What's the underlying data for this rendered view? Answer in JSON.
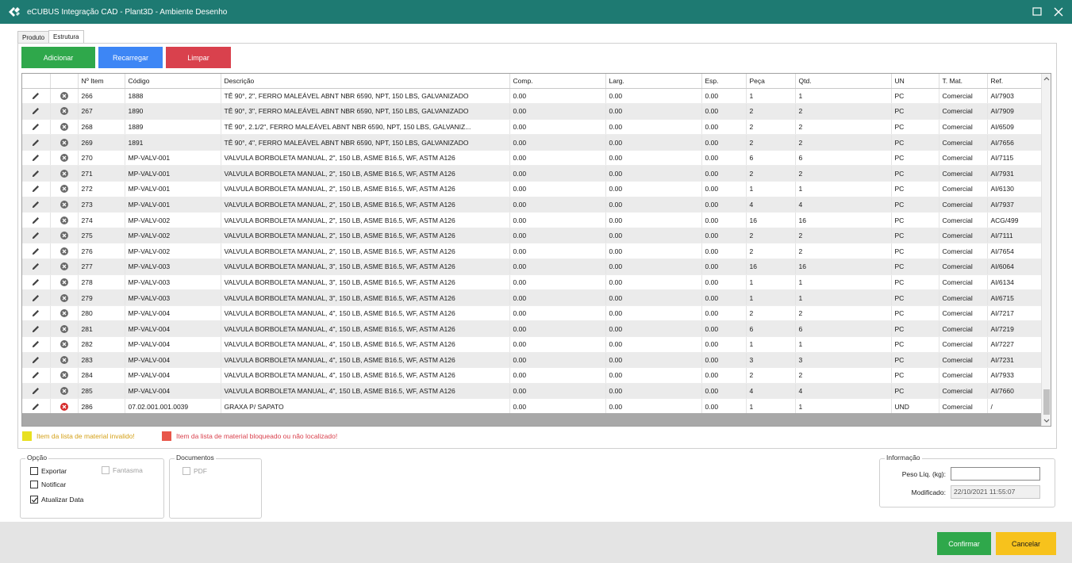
{
  "window": {
    "title": "eCUBUS Integração CAD - Plant3D - Ambiente Desenho"
  },
  "tabs": [
    {
      "label": "Produto",
      "active": false
    },
    {
      "label": "Estrutura",
      "active": true
    }
  ],
  "toolbar": {
    "add": "Adicionar",
    "reload": "Recarregar",
    "clear": "Limpar"
  },
  "grid": {
    "columns": [
      "",
      "",
      "Nº Item",
      "Código",
      "Descrição",
      "Comp.",
      "Larg.",
      "Esp.",
      "Peça",
      "Qtd.",
      "UN",
      "T. Mat.",
      "Ref."
    ],
    "rows": [
      {
        "item": "266",
        "codigo": "1888",
        "descricao": "TÊ 90°, 2\", FERRO MALEÁVEL ABNT NBR 6590, NPT, 150 LBS, GALVANIZADO",
        "comp": "0.00",
        "larg": "0.00",
        "esp": "0.00",
        "peca": "1",
        "qtd": "1",
        "un": "PC",
        "tmat": "Comercial",
        "ref": "AI/7903",
        "status": "ok"
      },
      {
        "item": "267",
        "codigo": "1890",
        "descricao": "TÊ 90°, 3\", FERRO MALEÁVEL ABNT NBR 6590, NPT, 150 LBS, GALVANIZADO",
        "comp": "0.00",
        "larg": "0.00",
        "esp": "0.00",
        "peca": "2",
        "qtd": "2",
        "un": "PC",
        "tmat": "Comercial",
        "ref": "AI/7909",
        "status": "ok"
      },
      {
        "item": "268",
        "codigo": "1889",
        "descricao": "TÊ 90°, 2.1/2\", FERRO MALEÁVEL ABNT NBR 6590, NPT, 150 LBS, GALVANIZ...",
        "comp": "0.00",
        "larg": "0.00",
        "esp": "0.00",
        "peca": "2",
        "qtd": "2",
        "un": "PC",
        "tmat": "Comercial",
        "ref": "AI/6509",
        "status": "ok"
      },
      {
        "item": "269",
        "codigo": "1891",
        "descricao": "TÊ 90°, 4\", FERRO MALEÁVEL ABNT NBR 6590, NPT, 150 LBS, GALVANIZADO",
        "comp": "0.00",
        "larg": "0.00",
        "esp": "0.00",
        "peca": "2",
        "qtd": "2",
        "un": "PC",
        "tmat": "Comercial",
        "ref": "AI/7656",
        "status": "ok"
      },
      {
        "item": "270",
        "codigo": "MP-VALV-001",
        "descricao": "VALVULA BORBOLETA MANUAL, 2\", 150 LB, ASME B16.5, WF, ASTM A126",
        "comp": "0.00",
        "larg": "0.00",
        "esp": "0.00",
        "peca": "6",
        "qtd": "6",
        "un": "PC",
        "tmat": "Comercial",
        "ref": "AI/7115",
        "status": "ok"
      },
      {
        "item": "271",
        "codigo": "MP-VALV-001",
        "descricao": "VALVULA BORBOLETA MANUAL, 2\", 150 LB, ASME B16.5, WF, ASTM A126",
        "comp": "0.00",
        "larg": "0.00",
        "esp": "0.00",
        "peca": "2",
        "qtd": "2",
        "un": "PC",
        "tmat": "Comercial",
        "ref": "AI/7931",
        "status": "ok"
      },
      {
        "item": "272",
        "codigo": "MP-VALV-001",
        "descricao": "VALVULA BORBOLETA MANUAL, 2\", 150 LB, ASME B16.5, WF, ASTM A126",
        "comp": "0.00",
        "larg": "0.00",
        "esp": "0.00",
        "peca": "1",
        "qtd": "1",
        "un": "PC",
        "tmat": "Comercial",
        "ref": "AI/6130",
        "status": "ok"
      },
      {
        "item": "273",
        "codigo": "MP-VALV-001",
        "descricao": "VALVULA BORBOLETA MANUAL, 2\", 150 LB, ASME B16.5, WF, ASTM A126",
        "comp": "0.00",
        "larg": "0.00",
        "esp": "0.00",
        "peca": "4",
        "qtd": "4",
        "un": "PC",
        "tmat": "Comercial",
        "ref": "AI/7937",
        "status": "ok"
      },
      {
        "item": "274",
        "codigo": "MP-VALV-002",
        "descricao": "VALVULA BORBOLETA MANUAL, 2\", 150 LB, ASME B16.5, WF, ASTM A126",
        "comp": "0.00",
        "larg": "0.00",
        "esp": "0.00",
        "peca": "16",
        "qtd": "16",
        "un": "PC",
        "tmat": "Comercial",
        "ref": "ACG/499",
        "status": "ok"
      },
      {
        "item": "275",
        "codigo": "MP-VALV-002",
        "descricao": "VALVULA BORBOLETA MANUAL, 2\", 150 LB, ASME B16.5, WF, ASTM A126",
        "comp": "0.00",
        "larg": "0.00",
        "esp": "0.00",
        "peca": "2",
        "qtd": "2",
        "un": "PC",
        "tmat": "Comercial",
        "ref": "AI/7111",
        "status": "ok"
      },
      {
        "item": "276",
        "codigo": "MP-VALV-002",
        "descricao": "VALVULA BORBOLETA MANUAL, 2\", 150 LB, ASME B16.5, WF, ASTM A126",
        "comp": "0.00",
        "larg": "0.00",
        "esp": "0.00",
        "peca": "2",
        "qtd": "2",
        "un": "PC",
        "tmat": "Comercial",
        "ref": "AI/7654",
        "status": "ok"
      },
      {
        "item": "277",
        "codigo": "MP-VALV-003",
        "descricao": "VALVULA BORBOLETA MANUAL, 3\", 150 LB, ASME B16.5, WF, ASTM A126",
        "comp": "0.00",
        "larg": "0.00",
        "esp": "0.00",
        "peca": "16",
        "qtd": "16",
        "un": "PC",
        "tmat": "Comercial",
        "ref": "AI/6064",
        "status": "ok"
      },
      {
        "item": "278",
        "codigo": "MP-VALV-003",
        "descricao": "VALVULA BORBOLETA MANUAL, 3\", 150 LB, ASME B16.5, WF, ASTM A126",
        "comp": "0.00",
        "larg": "0.00",
        "esp": "0.00",
        "peca": "1",
        "qtd": "1",
        "un": "PC",
        "tmat": "Comercial",
        "ref": "AI/6134",
        "status": "ok"
      },
      {
        "item": "279",
        "codigo": "MP-VALV-003",
        "descricao": "VALVULA BORBOLETA MANUAL, 3\", 150 LB, ASME B16.5, WF, ASTM A126",
        "comp": "0.00",
        "larg": "0.00",
        "esp": "0.00",
        "peca": "1",
        "qtd": "1",
        "un": "PC",
        "tmat": "Comercial",
        "ref": "AI/6715",
        "status": "ok"
      },
      {
        "item": "280",
        "codigo": "MP-VALV-004",
        "descricao": "VALVULA BORBOLETA MANUAL, 4\", 150 LB, ASME B16.5, WF, ASTM A126",
        "comp": "0.00",
        "larg": "0.00",
        "esp": "0.00",
        "peca": "2",
        "qtd": "2",
        "un": "PC",
        "tmat": "Comercial",
        "ref": "AI/7217",
        "status": "ok"
      },
      {
        "item": "281",
        "codigo": "MP-VALV-004",
        "descricao": "VALVULA BORBOLETA MANUAL, 4\", 150 LB, ASME B16.5, WF, ASTM A126",
        "comp": "0.00",
        "larg": "0.00",
        "esp": "0.00",
        "peca": "6",
        "qtd": "6",
        "un": "PC",
        "tmat": "Comercial",
        "ref": "AI/7219",
        "status": "ok"
      },
      {
        "item": "282",
        "codigo": "MP-VALV-004",
        "descricao": "VALVULA BORBOLETA MANUAL, 4\", 150 LB, ASME B16.5, WF, ASTM A126",
        "comp": "0.00",
        "larg": "0.00",
        "esp": "0.00",
        "peca": "1",
        "qtd": "1",
        "un": "PC",
        "tmat": "Comercial",
        "ref": "AI/7227",
        "status": "ok"
      },
      {
        "item": "283",
        "codigo": "MP-VALV-004",
        "descricao": "VALVULA BORBOLETA MANUAL, 4\", 150 LB, ASME B16.5, WF, ASTM A126",
        "comp": "0.00",
        "larg": "0.00",
        "esp": "0.00",
        "peca": "3",
        "qtd": "3",
        "un": "PC",
        "tmat": "Comercial",
        "ref": "AI/7231",
        "status": "ok"
      },
      {
        "item": "284",
        "codigo": "MP-VALV-004",
        "descricao": "VALVULA BORBOLETA MANUAL, 4\", 150 LB, ASME B16.5, WF, ASTM A126",
        "comp": "0.00",
        "larg": "0.00",
        "esp": "0.00",
        "peca": "2",
        "qtd": "2",
        "un": "PC",
        "tmat": "Comercial",
        "ref": "AI/7933",
        "status": "ok"
      },
      {
        "item": "285",
        "codigo": "MP-VALV-004",
        "descricao": "VALVULA BORBOLETA MANUAL, 4\", 150 LB, ASME B16.5, WF, ASTM A126",
        "comp": "0.00",
        "larg": "0.00",
        "esp": "0.00",
        "peca": "4",
        "qtd": "4",
        "un": "PC",
        "tmat": "Comercial",
        "ref": "AI/7660",
        "status": "ok"
      },
      {
        "item": "286",
        "codigo": "07.02.001.001.0039",
        "descricao": "GRAXA P/ SAPATO",
        "comp": "0.00",
        "larg": "0.00",
        "esp": "0.00",
        "peca": "1",
        "qtd": "1",
        "un": "UND",
        "tmat": "Comercial",
        "ref": "/",
        "status": "blocked"
      }
    ]
  },
  "legend": {
    "invalid": {
      "label": "Item da lista de material invalido!",
      "color": "#e8e020"
    },
    "blocked": {
      "label": "Item da lista de material bloqueado ou não localizado!",
      "color": "#e8564a"
    }
  },
  "opcao": {
    "title": "Opção",
    "exportar": {
      "label": "Exportar",
      "checked": false
    },
    "notificar": {
      "label": "Notificar",
      "checked": false
    },
    "atualizar_data": {
      "label": "Atualizar Data",
      "checked": true
    },
    "fantasma": {
      "label": "Fantasma",
      "checked": false
    }
  },
  "documentos": {
    "title": "Documentos",
    "pdf": {
      "label": "PDF",
      "checked": false
    }
  },
  "informacao": {
    "title": "Informação",
    "peso_label": "Peso Líq. (kg):",
    "peso_value": "",
    "modificado_label": "Modificado:",
    "modificado_value": "22/10/2021 11:55:07"
  },
  "footer": {
    "confirm": "Confirmar",
    "cancel": "Cancelar"
  },
  "colors": {
    "titlebar": "#1e7a72",
    "green": "#2fa84b",
    "blue": "#3d86f5",
    "red": "#d9414d",
    "yellow": "#f7c21c"
  }
}
